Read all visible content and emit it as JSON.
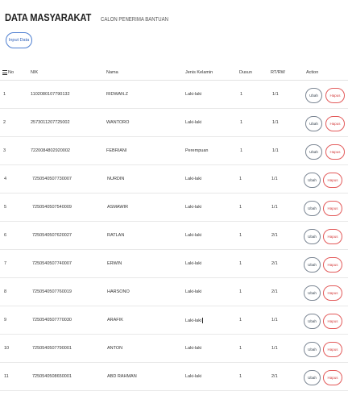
{
  "header": {
    "title": "DATA MASYARAKAT",
    "subtitle": "CALON PENERIMA BANTUAN",
    "input_button_label": "Input Data"
  },
  "table": {
    "columns": [
      "No",
      "NIK",
      "Nama",
      "Jenis Kelamin",
      "Dusun",
      "RT/RW",
      "Action"
    ],
    "ubah_label": "Ubah",
    "hapus_label": "Hapus",
    "rows": [
      {
        "no": "1",
        "nik": "1102080107790132",
        "nama": "RIDWAN.Z",
        "jk": "Laki-laki",
        "dusun": "1",
        "rtrw": "1/1"
      },
      {
        "no": "2",
        "nik": "2573011207725002",
        "nama": "WANTORO",
        "jk": "Laki-laki",
        "dusun": "1",
        "rtrw": "1/1"
      },
      {
        "no": "3",
        "nik": "7220084802920002",
        "nama": "FEBRIANI",
        "jk": "Perempuan",
        "dusun": "1",
        "rtrw": "1/1"
      },
      {
        "no": "4",
        "nik": "7250540507730007",
        "nama": "NURDIN",
        "jk": "Laki-laki",
        "dusun": "1",
        "rtrw": "1/1"
      },
      {
        "no": "5",
        "nik": "7250540507540009",
        "nama": "ASMAWIR",
        "jk": "Laki-laki",
        "dusun": "1",
        "rtrw": "1/1"
      },
      {
        "no": "6",
        "nik": "7250540507620027",
        "nama": "RATLAN",
        "jk": "Laki-laki",
        "dusun": "1",
        "rtrw": "2/1"
      },
      {
        "no": "7",
        "nik": "7250540507740007",
        "nama": "ERWIN",
        "jk": "Laki-laki",
        "dusun": "1",
        "rtrw": "2/1"
      },
      {
        "no": "8",
        "nik": "7250540507760019",
        "nama": "HARSONO",
        "jk": "Laki-laki",
        "dusun": "1",
        "rtrw": "2/1"
      },
      {
        "no": "9",
        "nik": "7250540507770030",
        "nama": "ARAFIK",
        "jk": "Laki-laki",
        "dusun": "1",
        "rtrw": "1/1"
      },
      {
        "no": "10",
        "nik": "7250540507790001",
        "nama": "ANTON",
        "jk": "Laki-laki",
        "dusun": "1",
        "rtrw": "1/1"
      },
      {
        "no": "11",
        "nik": "7250540508650001",
        "nama": "ABD RAHMAN",
        "jk": "Laki-laki",
        "dusun": "1",
        "rtrw": "2/1"
      }
    ]
  },
  "colors": {
    "primary_outline": "#4e7fd1",
    "danger_outline": "#e35a5a",
    "secondary_outline": "#7a8592"
  }
}
